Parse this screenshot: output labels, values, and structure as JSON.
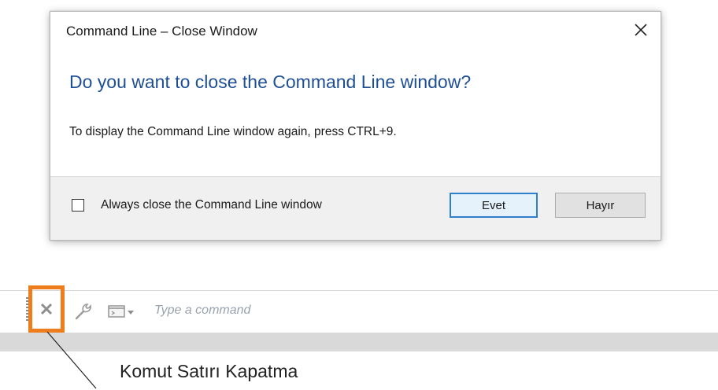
{
  "dialog": {
    "title": "Command Line – Close Window",
    "close_glyph": "✕",
    "main_instruction": "Do you want to close the Command Line window?",
    "content": "To display the Command Line window again, press CTRL+9.",
    "checkbox_label": "Always close the Command Line window",
    "checkbox_checked": false,
    "yes_label": "Evet",
    "no_label": "Hayır"
  },
  "command_line": {
    "placeholder": "Type a command",
    "icons": [
      "close-icon",
      "customize-wrench-icon",
      "recent-commands-icon"
    ],
    "highlight_color": "#ee7d1e"
  },
  "annotation": {
    "caption": "Komut Satırı Kapatma"
  },
  "colors": {
    "instruction": "#1e4f96",
    "default_button_border": "#2f7fcf"
  }
}
